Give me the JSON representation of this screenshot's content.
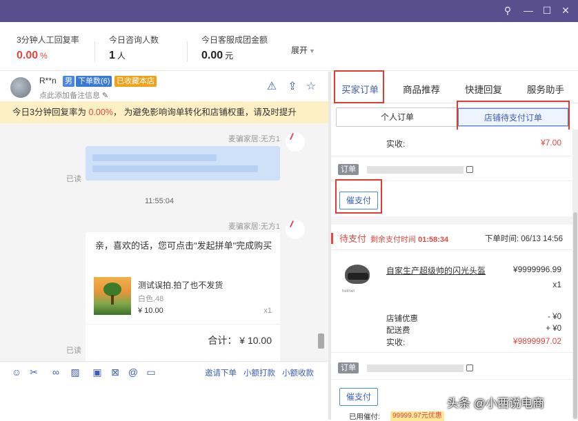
{
  "stats": {
    "reply_rate": {
      "label": "3分钟人工回复率",
      "value": "0.00",
      "unit": "%"
    },
    "consult_count": {
      "label": "今日咨询人数",
      "value": "1",
      "unit": "人"
    },
    "group_amount": {
      "label": "今日客服成团金额",
      "value": "0.00",
      "unit": "元"
    },
    "expand": "展开"
  },
  "user": {
    "name": "R**n",
    "gender_tag": "男",
    "orders_tag": "下单数(6)",
    "fav_tag": "已收藏本店",
    "remark": "点此添加备注信息"
  },
  "notice": {
    "prefix": "今日3分钟回复率为 ",
    "pct": "0.00%",
    "suffix": "， 为避免影响询单转化和店铺权重，请及时提升"
  },
  "chat": {
    "sender1": "麦骗家居:无方1",
    "read1": "已读",
    "time": "11:55:04",
    "sender2": "麦骗家居:无方1",
    "card_msg": "亲，喜欢的话，您可点击\"发起拼单\"完成购买",
    "product_name": "测试误拍.拍了也不发货",
    "product_spec": "白色,48",
    "product_price": "¥ 10.00",
    "product_qty": "x1",
    "total": "合计： ¥ 10.00",
    "read2": "已读"
  },
  "toolbar": {
    "invite": "邀请下单",
    "small_pay": "小额打款",
    "small_receive": "小额收款"
  },
  "right_tabs": [
    "买家订单",
    "商品推荐",
    "快捷回复",
    "服务助手"
  ],
  "sub_tabs": [
    "个人订单",
    "店铺待支付订单"
  ],
  "order1": {
    "paid_label": "实收:",
    "paid_value": "¥7.00",
    "order_tag": "订单",
    "remind": "催支付"
  },
  "order2": {
    "status": "待支付",
    "countdown_label": "剩余支付时间",
    "countdown": "01:58:34",
    "order_time": "下单时间: 06/13 14:56",
    "product": "自家生产超级帅的闪光头盔",
    "price": "¥9999996.99",
    "qty": "x1",
    "shop_discount_label": "店铺优惠",
    "shop_discount": "- ¥0",
    "shipping_label": "配送费",
    "shipping": "+ ¥0",
    "paid_label": "实收:",
    "paid_value": "¥9899997.02",
    "order_tag": "订单",
    "remind": "催支付",
    "used_label": "已用催付:",
    "used_value": "99999.97元优惠"
  },
  "watermark": "头条 @小西说电商"
}
